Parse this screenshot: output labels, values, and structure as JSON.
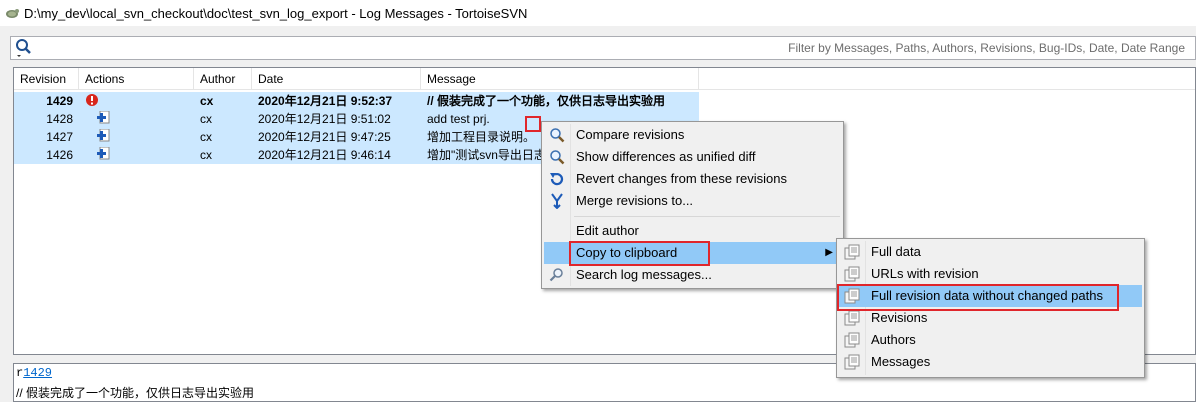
{
  "window": {
    "title": "D:\\my_dev\\local_svn_checkout\\doc\\test_svn_log_export - Log Messages - TortoiseSVN"
  },
  "filter": {
    "placeholder": "Filter by Messages, Paths, Authors, Revisions, Bug-IDs, Date, Date Range",
    "value": ""
  },
  "log_table": {
    "columns": [
      "Revision",
      "Actions",
      "Author",
      "Date",
      "Message"
    ],
    "rows": [
      {
        "revision": "1429",
        "action": "error-icon",
        "author": "cx",
        "date": "2020年12月21日 9:52:37",
        "message": "// 假装完成了一个功能，仅供日志导出实验用"
      },
      {
        "revision": "1428",
        "action": "add-icon",
        "author": "cx",
        "date": "2020年12月21日 9:51:02",
        "message": "add test prj."
      },
      {
        "revision": "1427",
        "action": "add-icon",
        "author": "cx",
        "date": "2020年12月21日 9:47:25",
        "message": "增加工程目录说明。"
      },
      {
        "revision": "1426",
        "action": "add-icon",
        "author": "cx",
        "date": "2020年12月21日 9:46:14",
        "message": "增加\"测试svn导出日志"
      }
    ]
  },
  "message_pane": {
    "prefix": "r",
    "revision_link": "1429",
    "text": "// 假装完成了一个功能，仅供日志导出实验用"
  },
  "context_menu": {
    "items": [
      {
        "label": "Compare revisions",
        "icon": "magnifier-icon"
      },
      {
        "label": "Show differences as unified diff",
        "icon": "magnifier-icon"
      },
      {
        "label": "Revert changes from these revisions",
        "icon": "revert-icon"
      },
      {
        "label": "Merge revisions to...",
        "icon": "merge-icon"
      },
      {
        "label": "Edit author",
        "icon": ""
      },
      {
        "label": "Copy to clipboard",
        "icon": "",
        "submenu": true
      },
      {
        "label": "Search log messages...",
        "icon": "search-icon"
      }
    ]
  },
  "clipboard_submenu": {
    "items": [
      {
        "label": "Full data",
        "icon": "document-icon"
      },
      {
        "label": "URLs with revision",
        "icon": "document-icon"
      },
      {
        "label": "Full revision data without changed paths",
        "icon": "document-icon"
      },
      {
        "label": "Revisions",
        "icon": "document-icon"
      },
      {
        "label": "Authors",
        "icon": "document-icon"
      },
      {
        "label": "Messages",
        "icon": "document-icon"
      }
    ]
  },
  "colors": {
    "row_selected": "#cce8ff",
    "menu_highlight": "#91c9f7",
    "annotation_red": "#e0262b"
  }
}
